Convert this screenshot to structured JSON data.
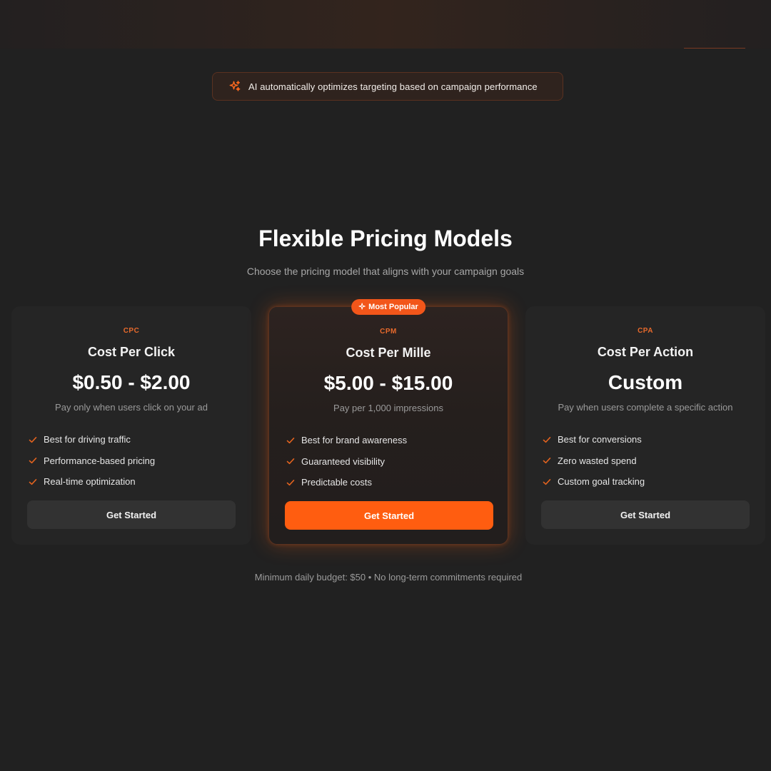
{
  "banner": {
    "icon": "sparkles-icon",
    "text": "AI automatically optimizes targeting based on campaign performance"
  },
  "section": {
    "title": "Flexible Pricing Models",
    "subtitle": "Choose the pricing model that aligns with your campaign goals"
  },
  "plans": [
    {
      "code": "CPC",
      "name": "Cost Per Click",
      "price": "$0.50 - $2.00",
      "description": "Pay only when users click on your ad",
      "features": [
        "Best for driving traffic",
        "Performance-based pricing",
        "Real-time optimization"
      ],
      "cta": "Get Started"
    },
    {
      "badge": "Most Popular",
      "code": "CPM",
      "name": "Cost Per Mille",
      "price": "$5.00 - $15.00",
      "description": "Pay per 1,000 impressions",
      "features": [
        "Best for brand awareness",
        "Guaranteed visibility",
        "Predictable costs"
      ],
      "cta": "Get Started"
    },
    {
      "code": "CPA",
      "name": "Cost Per Action",
      "price": "Custom",
      "description": "Pay when users complete a specific action",
      "features": [
        "Best for conversions",
        "Zero wasted spend",
        "Custom goal tracking"
      ],
      "cta": "Get Started"
    }
  ],
  "footnote": "Minimum daily budget: $50 • No long-term commitments required",
  "colors": {
    "accent": "#ff5d10",
    "background": "#212121",
    "card": "#252525"
  }
}
